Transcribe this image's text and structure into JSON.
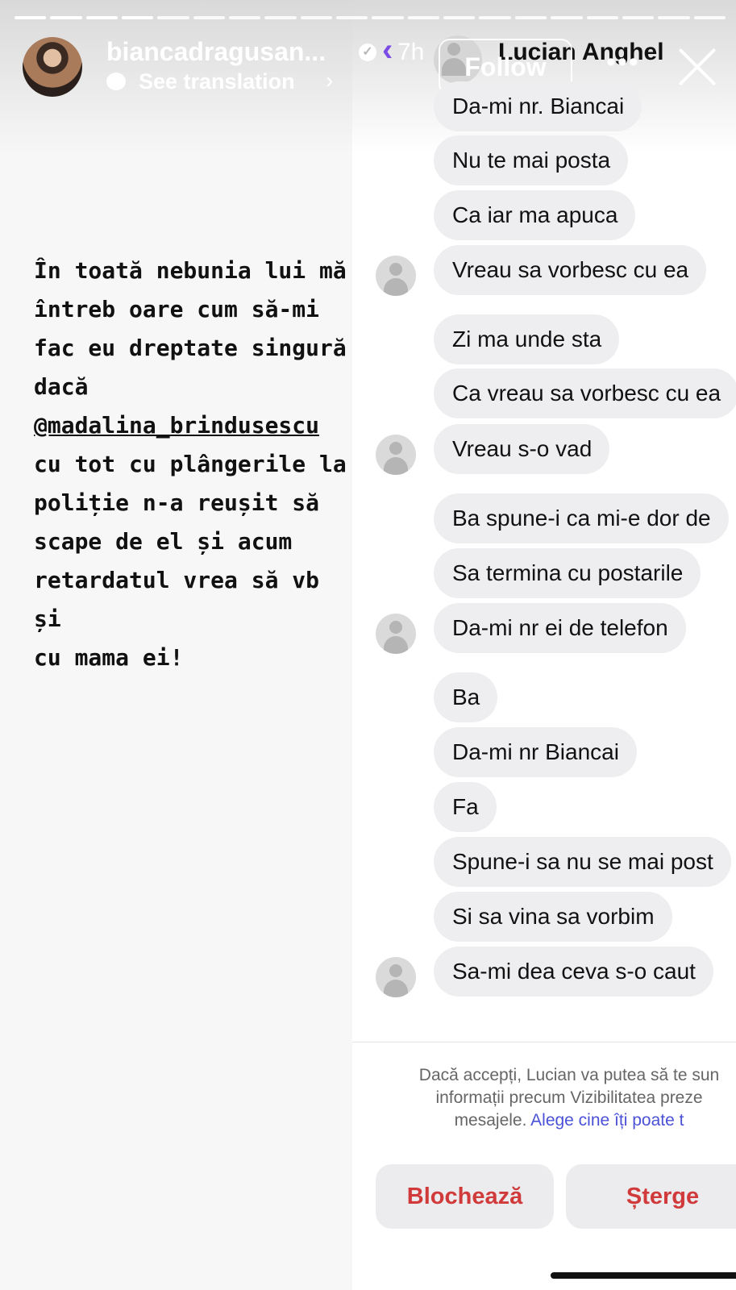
{
  "story": {
    "username": "biancadragusan...",
    "time": "7h",
    "see_translation": "See translation",
    "follow_label": "Follow",
    "text_lines": [
      "În toată nebunia lui mă",
      "întreb oare cum să-mi",
      "fac eu dreptate singură",
      "dacă"
    ],
    "mention": "@madalina_brindusescu",
    "text_lines_after": [
      "cu tot cu plângerile la",
      "poliție n-a reușit să",
      "scape de el și acum",
      "retardatul vrea să vb și",
      "cu mama ei!"
    ]
  },
  "chat": {
    "contact_name": "Lucian Anghel",
    "messages": [
      "Da-mi nr. Biancai",
      "Nu te mai posta",
      "Ca iar ma apuca",
      "Vreau sa vorbesc cu ea",
      "Zi ma unde sta",
      "Ca vreau sa vorbesc cu ea",
      "Vreau s-o vad",
      "Ba spune-i ca mi-e dor de",
      "Sa termina cu postarile",
      "Da-mi nr ei de telefon",
      "Ba",
      "Da-mi nr Biancai",
      "Fa",
      "Spune-i sa nu se mai post",
      "Si sa vina sa vorbim",
      "Sa-mi dea ceva s-o caut"
    ],
    "notice_line1": "Dacă accepți, Lucian va putea să te sun",
    "notice_line2": "informații precum Vizibilitatea preze",
    "notice_line3": "mesajele.",
    "notice_link": "Alege cine îți poate t",
    "block_label": "Blochează",
    "delete_label": "Șterge"
  },
  "icons": {
    "verified": "verified-badge-icon",
    "back": "chevron-left-icon",
    "more": "more-options-icon",
    "close": "close-icon"
  },
  "colors": {
    "link": "#4b51d6",
    "destructive": "#d13a3a",
    "bubble": "#eeeef0"
  }
}
